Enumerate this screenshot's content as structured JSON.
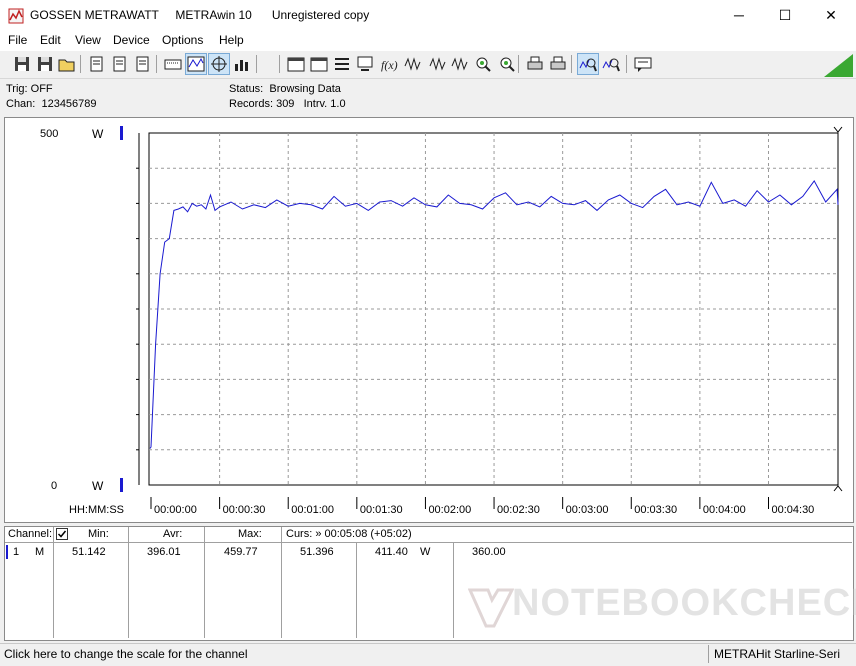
{
  "window": {
    "title": "GOSSEN METRAWATT     METRAwin 10      Unregistered copy",
    "minimize_glyph": "─",
    "maximize_glyph": "☐",
    "close_glyph": "✕"
  },
  "menu": [
    "File",
    "Edit",
    "View",
    "Device",
    "Options",
    "Help"
  ],
  "toolbar_icons": [
    "save-icon",
    "save-as-icon",
    "open-folder-icon",
    "print-setup-icon",
    "page-icon",
    "page-icon",
    "keyboard-icon",
    "scope-icon",
    "crosshair-icon",
    "bar-icon",
    "window-icon",
    "window-icon",
    "list-icon",
    "computer-icon",
    "function-icon",
    "wave-icon",
    "wave-icon",
    "wave-icon",
    "zoom-icon",
    "zoom-icon",
    "print-icon",
    "printer-icon",
    "zoom-wave-icon",
    "zoom-wave-icon",
    "comment-icon"
  ],
  "status": {
    "trig": "Trig: OFF",
    "chan": "Chan:  123456789",
    "status": "Status:  Browsing Data",
    "records": "Records: 309   Intrv. 1.0"
  },
  "chart_data": {
    "type": "line",
    "y_top_label": "500",
    "y_bottom_label": "0",
    "y_unit_top": "W",
    "y_unit_bottom": "W",
    "ylim": [
      0,
      500
    ],
    "x_axis_label": "HH:MM:SS",
    "x_ticks": [
      "00:00:00",
      "00:00:30",
      "00:01:00",
      "00:01:30",
      "00:02:00",
      "00:02:30",
      "00:03:00",
      "00:03:30",
      "00:04:00",
      "00:04:30"
    ],
    "grid": true,
    "series_color": "#1a1ad0",
    "series": [
      {
        "x_seconds": [
          -10,
          -2,
          0,
          2,
          4,
          6,
          8,
          10,
          12,
          14,
          16,
          18,
          20,
          22,
          24,
          26,
          28,
          30,
          35,
          40,
          45,
          50,
          55,
          60,
          65,
          70,
          75,
          80,
          85,
          90,
          95,
          100,
          105,
          110,
          115,
          120,
          125,
          130,
          135,
          140,
          145,
          150,
          155,
          160,
          165,
          170,
          175,
          180,
          185,
          190,
          195,
          200,
          205,
          210,
          215,
          220,
          225,
          230,
          235,
          240,
          245,
          250,
          255,
          260,
          265,
          270,
          275,
          280,
          285,
          290,
          295,
          300,
          305,
          308
        ],
        "values": [
          52,
          52,
          54,
          200,
          300,
          345,
          350,
          390,
          392,
          395,
          388,
          400,
          396,
          398,
          392,
          412,
          390,
          395,
          402,
          392,
          398,
          394,
          405,
          396,
          400,
          398,
          392,
          410,
          396,
          400,
          390,
          402,
          404,
          396,
          408,
          398,
          395,
          412,
          400,
          398,
          392,
          408,
          415,
          398,
          402,
          395,
          410,
          400,
          398,
          404,
          390,
          405,
          412,
          400,
          394,
          410,
          420,
          398,
          402,
          396,
          430,
          400,
          405,
          396,
          418,
          402,
          412,
          398,
          410,
          432,
          402,
          420,
          398,
          402
        ]
      }
    ]
  },
  "table": {
    "headers": {
      "channel": "Channel:",
      "min": "Min:",
      "avr": "Avr:",
      "max": "Max:",
      "curs": "Curs: » 00:05:08 (+05:02)"
    },
    "row": {
      "chan_num": "1",
      "chan_mode": "M",
      "min": "51.142",
      "avr": "396.01",
      "max": "459.77",
      "curs1": "51.396",
      "curs2": "411.40",
      "unit": "W",
      "extra": "360.00"
    },
    "watermark": "NOTEBOOKCHECK"
  },
  "statusbar": {
    "left": "Click here to change the scale for the channel",
    "right": "METRAHit Starline-Seri"
  }
}
